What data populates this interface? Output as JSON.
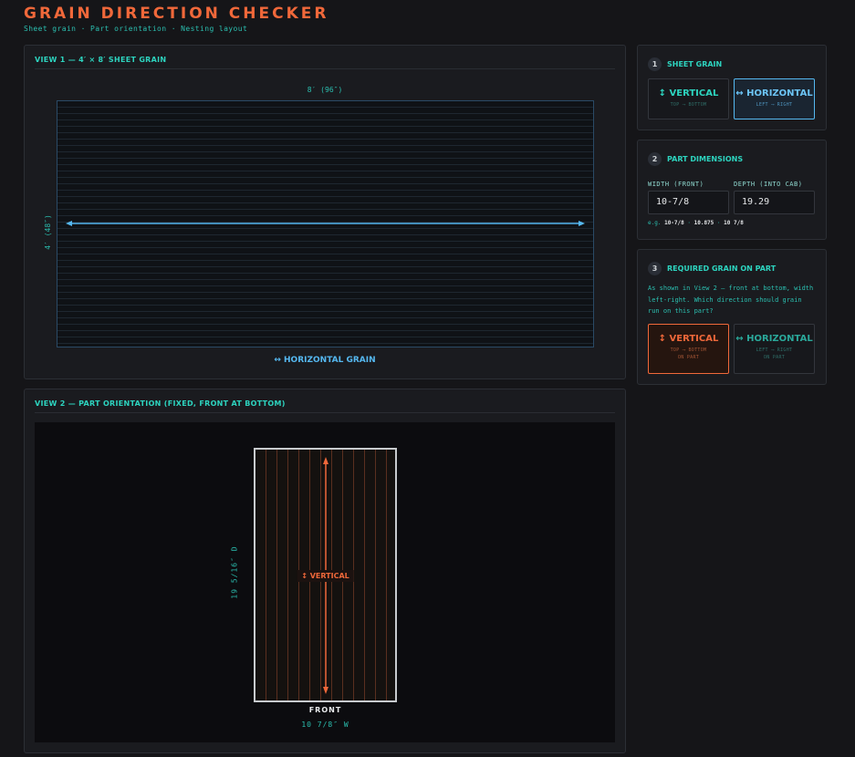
{
  "header": {
    "title": "GRAIN DIRECTION CHECKER",
    "subtitle": "Sheet grain · Part orientation · Nesting layout"
  },
  "view1": {
    "title": "VIEW 1 — 4′ × 8′ SHEET GRAIN",
    "top_dimension": "8′ (96″)",
    "side_dimension": "4′ (48″)",
    "grain_label": "↔ HORIZONTAL GRAIN"
  },
  "view2": {
    "title": "VIEW 2 — PART ORIENTATION (FIXED, FRONT AT BOTTOM)",
    "depth_dimension": "19 5/16″ D",
    "grain_badge": "↕ VERTICAL",
    "front_label": "FRONT",
    "width_dimension": "10 7/8″ W"
  },
  "step1": {
    "number": "1",
    "title": "SHEET GRAIN",
    "options": [
      {
        "label": "↕ VERTICAL",
        "sub": "TOP ⟶ BOTTOM",
        "selected": false
      },
      {
        "label": "↔ HORIZONTAL",
        "sub": "LEFT ⟶ RIGHT",
        "selected": true
      }
    ]
  },
  "step2": {
    "number": "2",
    "title": "PART DIMENSIONS",
    "width_label": "WIDTH (FRONT)",
    "width_value": "10-7/8",
    "depth_label": "DEPTH (INTO CAB)",
    "depth_value": "19.29",
    "example_prefix": "e.g.",
    "example_1": "10-7/8",
    "example_2": "10.875",
    "example_3": "10 7/8"
  },
  "step3": {
    "number": "3",
    "title": "REQUIRED GRAIN ON PART",
    "description": "As shown in View 2 — front at bottom, width left-right. Which direction should grain run on this part?",
    "options": [
      {
        "label": "↕ VERTICAL",
        "sub": "TOP ⟶ BOTTOM",
        "sub2": "ON PART",
        "selected": true
      },
      {
        "label": "↔ HORIZONTAL",
        "sub": "LEFT ⟶ RIGHT",
        "sub2": "ON PART",
        "selected": false
      }
    ]
  },
  "colors": {
    "accent_orange": "#f0683a",
    "accent_teal": "#2dd4bf",
    "accent_blue": "#55b8f0",
    "background": "#151518"
  }
}
